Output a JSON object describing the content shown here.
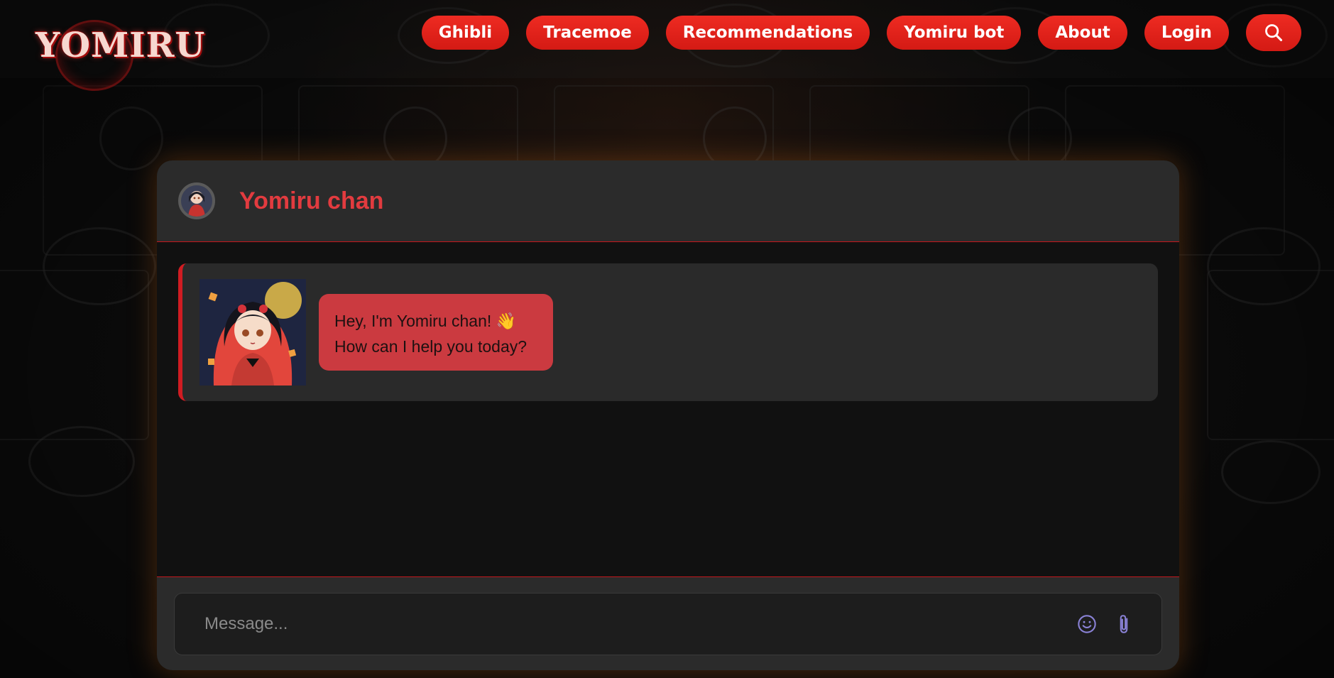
{
  "brand": {
    "logo_text": "YOMIRU"
  },
  "nav": {
    "items": [
      {
        "label": "Ghibli"
      },
      {
        "label": "Tracemoe"
      },
      {
        "label": "Recommendations"
      },
      {
        "label": "Yomiru bot"
      },
      {
        "label": "About"
      },
      {
        "label": "Login"
      }
    ],
    "search_icon": "search-icon"
  },
  "chat": {
    "title": "Yomiru chan",
    "messages": [
      {
        "sender": "bot",
        "line1": "Hey, I'm Yomiru chan! 👋",
        "line2": "How can I help you today?"
      }
    ],
    "input": {
      "placeholder": "Message...",
      "value": ""
    },
    "icons": {
      "emoji": "smile-icon",
      "attach": "paperclip-icon"
    }
  },
  "colors": {
    "accent": "#e3221b",
    "title": "#e23b3f",
    "bubble": "#cb3a40",
    "card": "#2b2b2b",
    "icon": "#8a82d6"
  }
}
